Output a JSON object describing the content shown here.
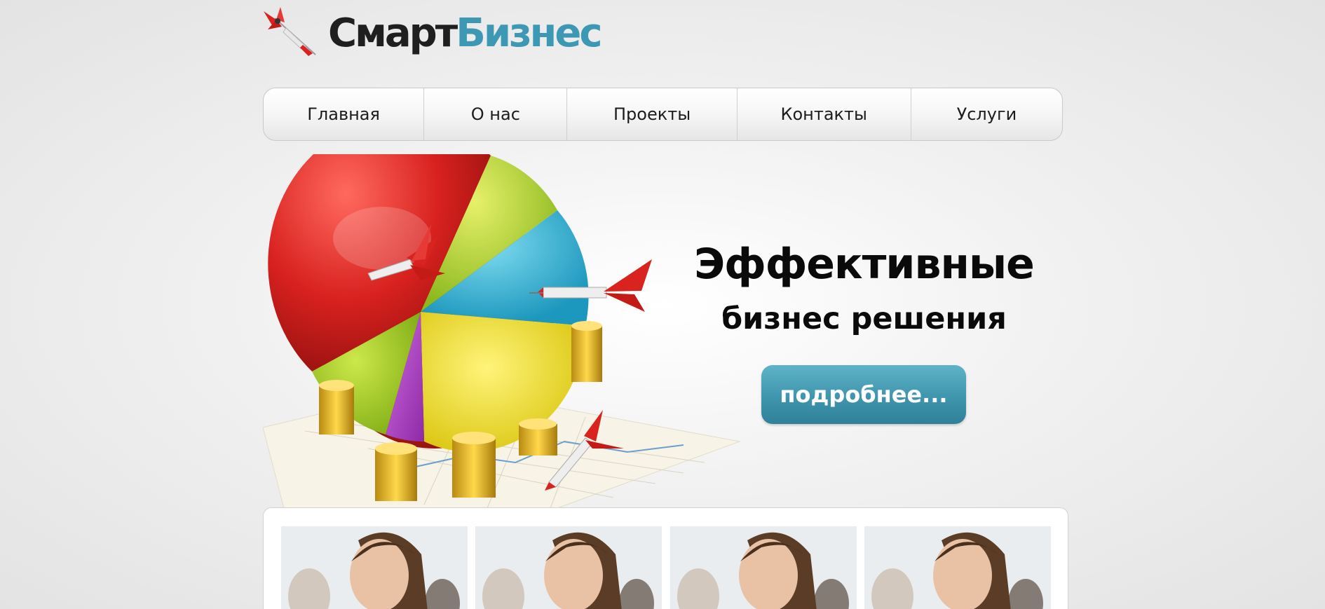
{
  "logo": {
    "part1": "Смарт",
    "part2": "Бизнес",
    "icon": "dart-icon",
    "color_dark": "#1f1f1f",
    "color_accent": "#3d98b4"
  },
  "nav": {
    "items": [
      {
        "label": "Главная"
      },
      {
        "label": "О нас"
      },
      {
        "label": "Проекты"
      },
      {
        "label": "Контакты"
      },
      {
        "label": "Услуги"
      }
    ]
  },
  "hero": {
    "title": "Эффективные",
    "subtitle": "бизнес решения",
    "button_label": "подробнее...",
    "button_color": "#3f95ad",
    "image": "pie-chart-with-darts-and-coins"
  },
  "gallery": {
    "items": [
      {
        "image": "woman-looking-up-photo"
      },
      {
        "image": "woman-looking-up-photo"
      },
      {
        "image": "woman-looking-up-photo"
      },
      {
        "image": "woman-looking-up-photo"
      }
    ]
  }
}
